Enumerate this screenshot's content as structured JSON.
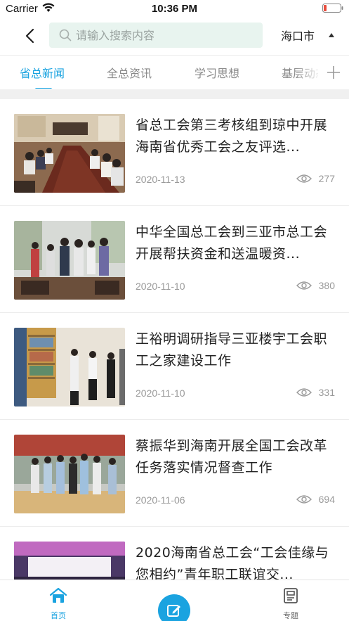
{
  "status_bar": {
    "carrier": "Carrier",
    "time": "10:36 PM",
    "wifi_icon": "wifi-icon",
    "battery_icon": "battery-low-icon",
    "battery_color": "#e84c3d"
  },
  "header": {
    "back_icon": "chevron-left-icon",
    "search_placeholder": "请输入搜索内容",
    "search_value": "",
    "city": "海口市"
  },
  "tabs": [
    {
      "label": "省总新闻",
      "active": true
    },
    {
      "label": "全总资讯",
      "active": false
    },
    {
      "label": "学习思想",
      "active": false
    },
    {
      "label": "基层动态",
      "active": false
    }
  ],
  "tab_add_icon": "plus-icon",
  "news": [
    {
      "title": "省总工会第三考核组到琼中开展海南省优秀工会之友评选...",
      "date": "2020-11-13",
      "views": "277"
    },
    {
      "title": "中华全国总工会到三亚市总工会开展帮扶资金和送温暖资...",
      "date": "2020-11-10",
      "views": "380"
    },
    {
      "title": "王裕明调研指导三亚楼宇工会职工之家建设工作",
      "date": "2020-11-10",
      "views": "331"
    },
    {
      "title": "蔡振华到海南开展全国工会改革任务落实情况督查工作",
      "date": "2020-11-06",
      "views": "694"
    },
    {
      "title": "2020海南省总工会“工会佳缘与您相约”青年职工联谊交...",
      "date": "",
      "views": ""
    }
  ],
  "bottom_nav": {
    "home_label": "首页",
    "topic_label": "专题",
    "home_icon": "home-icon",
    "compose_icon": "edit-icon",
    "topic_icon": "document-icon"
  },
  "colors": {
    "accent": "#1aa3e0",
    "search_bg": "#e8f4ef"
  }
}
